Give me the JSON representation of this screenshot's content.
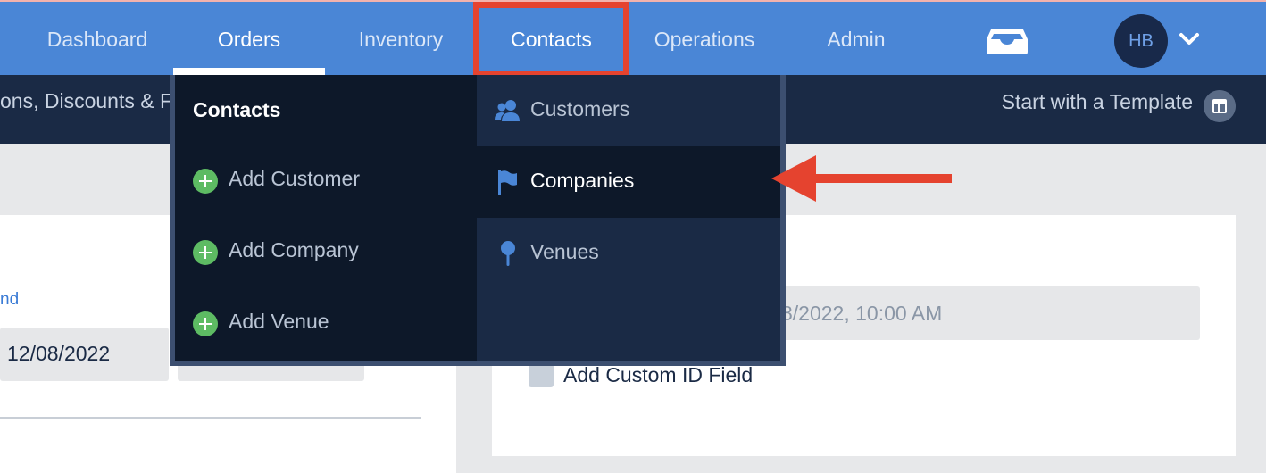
{
  "topnav": {
    "items": [
      {
        "label": "Dashboard"
      },
      {
        "label": "Orders"
      },
      {
        "label": "Inventory"
      },
      {
        "label": "Contacts"
      },
      {
        "label": "Operations"
      },
      {
        "label": "Admin"
      }
    ],
    "active": "Orders",
    "highlighted": "Contacts",
    "avatar_initials": "HB",
    "icons": [
      "inbox-icon",
      "chevron-down-icon"
    ]
  },
  "subnav": {
    "left_text": "ons, Discounts & Fe",
    "template_link": "Start with a Template",
    "template_icon": "layout-template-icon"
  },
  "content": {
    "left": {
      "link_text": "nd",
      "date_value": "12/08/2022"
    },
    "right": {
      "datetime_value": "8/2022, 10:00 AM",
      "checkbox_label": "Add Custom ID Field",
      "checkbox_checked": false
    }
  },
  "dropdown": {
    "heading": "Contacts",
    "add_items": [
      {
        "label": "Add Customer",
        "icon": "plus-circle-icon"
      },
      {
        "label": "Add Company",
        "icon": "plus-circle-icon"
      },
      {
        "label": "Add Venue",
        "icon": "plus-circle-icon"
      }
    ],
    "nav_items": [
      {
        "label": "Customers",
        "icon": "users-icon"
      },
      {
        "label": "Companies",
        "icon": "flag-icon"
      },
      {
        "label": "Venues",
        "icon": "map-pin-icon"
      }
    ],
    "selected": "Companies"
  },
  "annotations": {
    "highlight_color": "#e5432f",
    "arrow_target": "Companies"
  },
  "colors": {
    "nav_blue": "#4a86d6",
    "dark_navy": "#1a2a45",
    "darker_navy": "#0d1829",
    "plus_green": "#5dbb63"
  }
}
